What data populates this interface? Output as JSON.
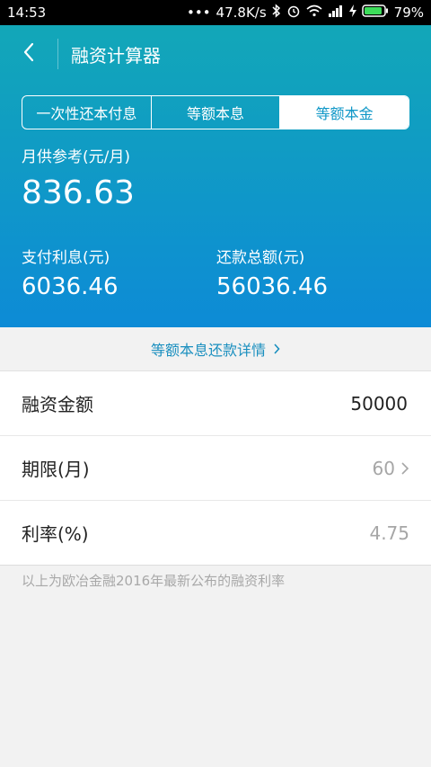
{
  "status": {
    "time": "14:53",
    "speed": "47.8K/s",
    "battery": "79%"
  },
  "header": {
    "title": "融资计算器"
  },
  "tabs": [
    {
      "label": "一次性还本付息"
    },
    {
      "label": "等额本息"
    },
    {
      "label": "等额本金"
    }
  ],
  "summary": {
    "monthly_label": "月供参考(元/月)",
    "monthly_value": "836.63",
    "interest_label": "支付利息(元)",
    "interest_value": "6036.46",
    "total_label": "还款总额(元)",
    "total_value": "56036.46"
  },
  "details_link": "等额本息还款详情",
  "form": {
    "amount_label": "融资金额",
    "amount_value": "50000",
    "term_label": "期限(月)",
    "term_value": "60",
    "rate_label": "利率(%)",
    "rate_value": "4.75"
  },
  "note": "以上为欧冶金融2016年最新公布的融资利率"
}
